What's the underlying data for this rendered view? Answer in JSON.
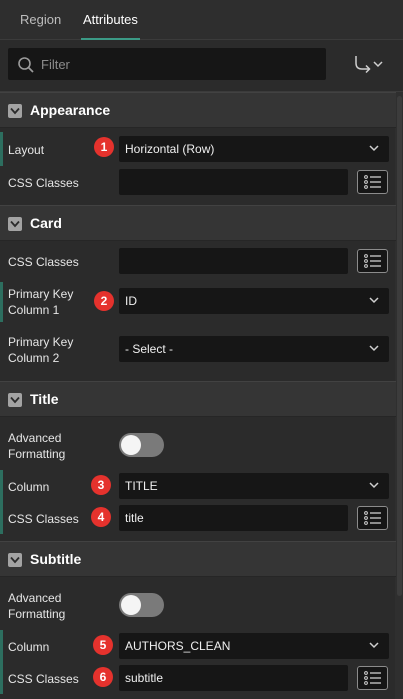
{
  "tabs": {
    "region": "Region",
    "attributes": "Attributes"
  },
  "filter": {
    "placeholder": "Filter"
  },
  "sections": {
    "appearance": {
      "title": "Appearance",
      "layout": {
        "label": "Layout",
        "badge": "1",
        "value": "Horizontal (Row)"
      },
      "css": {
        "label": "CSS Classes",
        "value": ""
      }
    },
    "card": {
      "title": "Card",
      "css": {
        "label": "CSS Classes",
        "value": ""
      },
      "pk1": {
        "label_line1": "Primary Key",
        "label_line2": "Column 1",
        "badge": "2",
        "value": "ID"
      },
      "pk2": {
        "label_line1": "Primary Key",
        "label_line2": "Column 2",
        "value": "- Select -"
      }
    },
    "title": {
      "title": "Title",
      "adv": {
        "label_line1": "Advanced",
        "label_line2": "Formatting",
        "on": false
      },
      "column": {
        "label": "Column",
        "badge": "3",
        "value": "TITLE"
      },
      "css": {
        "label": "CSS Classes",
        "badge": "4",
        "value": "title"
      }
    },
    "subtitle": {
      "title": "Subtitle",
      "adv": {
        "label_line1": "Advanced",
        "label_line2": "Formatting",
        "on": false
      },
      "column": {
        "label": "Column",
        "badge": "5",
        "value": "AUTHORS_CLEAN"
      },
      "css": {
        "label": "CSS Classes",
        "badge": "6",
        "value": "subtitle"
      }
    }
  },
  "colors": {
    "accent": "#3b9a86",
    "badge": "#e5322d",
    "field_bg": "#161616",
    "panel_bg": "#2b2b2b"
  },
  "icons": {
    "search": "search-icon",
    "goto": "goto-arrow-icon",
    "list": "list-icon",
    "section": "collapse-chevron-icon"
  }
}
